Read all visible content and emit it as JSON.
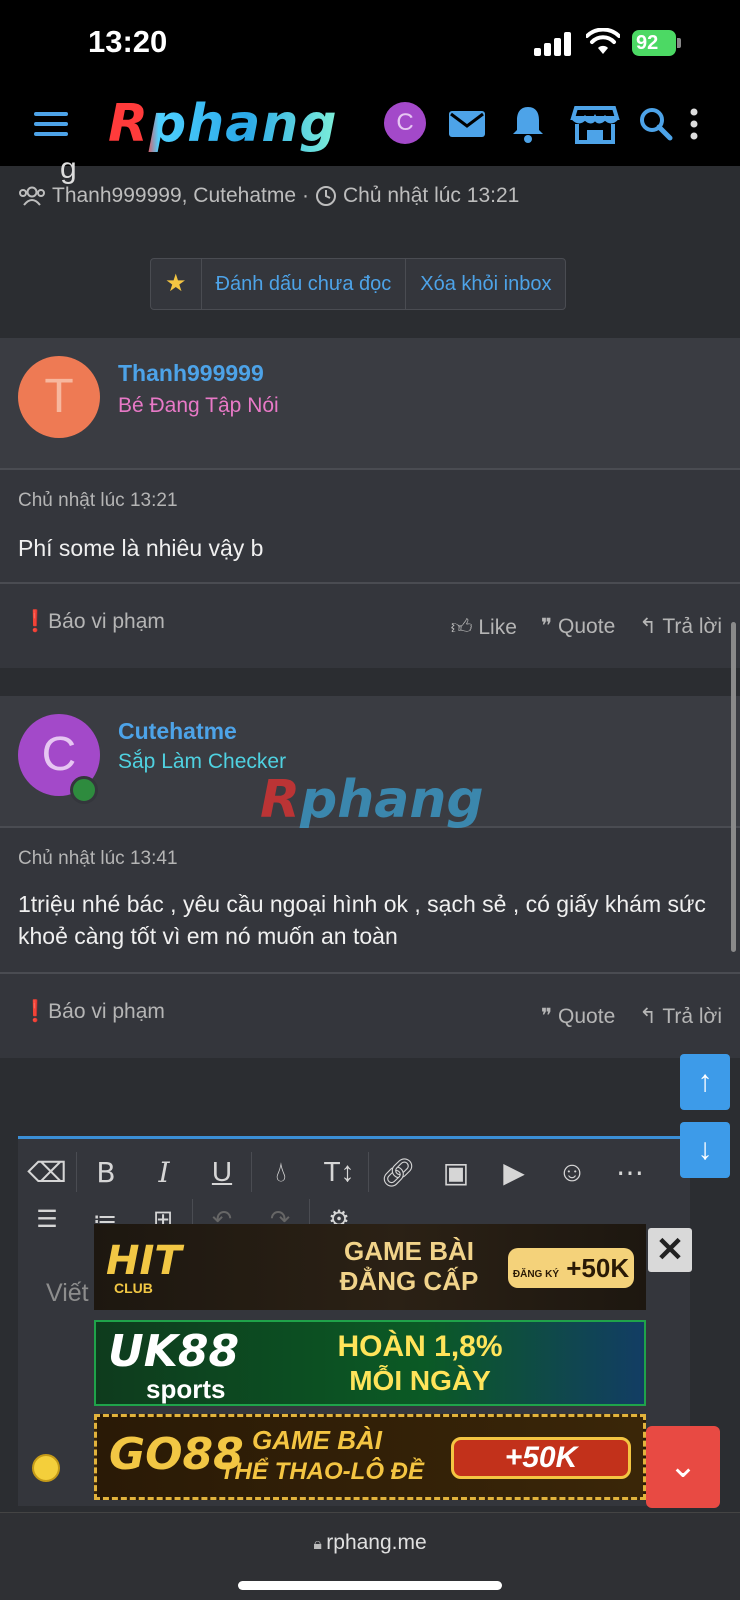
{
  "status": {
    "time": "13:20",
    "battery": "92"
  },
  "nav": {
    "logo": "Rphang",
    "avatar_letter": "C"
  },
  "thread": {
    "title_clip": "g",
    "participants": "Thanh999999, Cutehatme",
    "separator": "·",
    "date": "Chủ nhật lúc 13:21"
  },
  "buttons": {
    "mark_unread": "Đánh dấu chưa đọc",
    "remove_inbox": "Xóa khỏi inbox"
  },
  "posts": [
    {
      "avatar_letter": "T",
      "username": "Thanh999999",
      "user_title": "Bé Đang Tập Nói",
      "date": "Chủ nhật lúc 13:21",
      "body": "Phí some là nhiêu vậy b",
      "report": "Báo vi phạm",
      "like": "Like",
      "quote": "Quote",
      "reply": "Trả lời"
    },
    {
      "avatar_letter": "C",
      "username": "Cutehatme",
      "user_title": "Sắp Làm Checker",
      "date": "Chủ nhật lúc 13:41",
      "body": "1triệu nhé bác , yêu cầu ngoại hình ok , sạch sẻ , có giấy khám sức khoẻ càng tốt vì em nó muốn an toàn",
      "report": "Báo vi phạm",
      "quote": "Quote",
      "reply": "Trả lời"
    }
  ],
  "watermark": {
    "r": "R",
    "rest": "phang"
  },
  "editor": {
    "placeholder": "Viết"
  },
  "ads": [
    {
      "brand": "HIT",
      "brand_sub": "CLUB",
      "line1": "GAME BÀI",
      "line2": "ĐẲNG CẤP",
      "badge_small": "ĐĂNG KÝ",
      "badge": "+50K"
    },
    {
      "brand": "UK88",
      "brand_sub": "sports",
      "line1": "HOÀN 1,8%",
      "line2": "MỖI NGÀY"
    },
    {
      "brand": "GO88",
      "line1": "GAME BÀI",
      "line2": "THỂ THAO-LÔ ĐỀ",
      "badge": "+50K"
    }
  ],
  "browser": {
    "url": "rphang.me"
  },
  "colors": {
    "accent": "#4da3e8",
    "pink_title": "#e879c7",
    "cyan_title": "#4fd1e0",
    "avatar_t": "#ee7a54",
    "avatar_c": "#a349c9"
  }
}
